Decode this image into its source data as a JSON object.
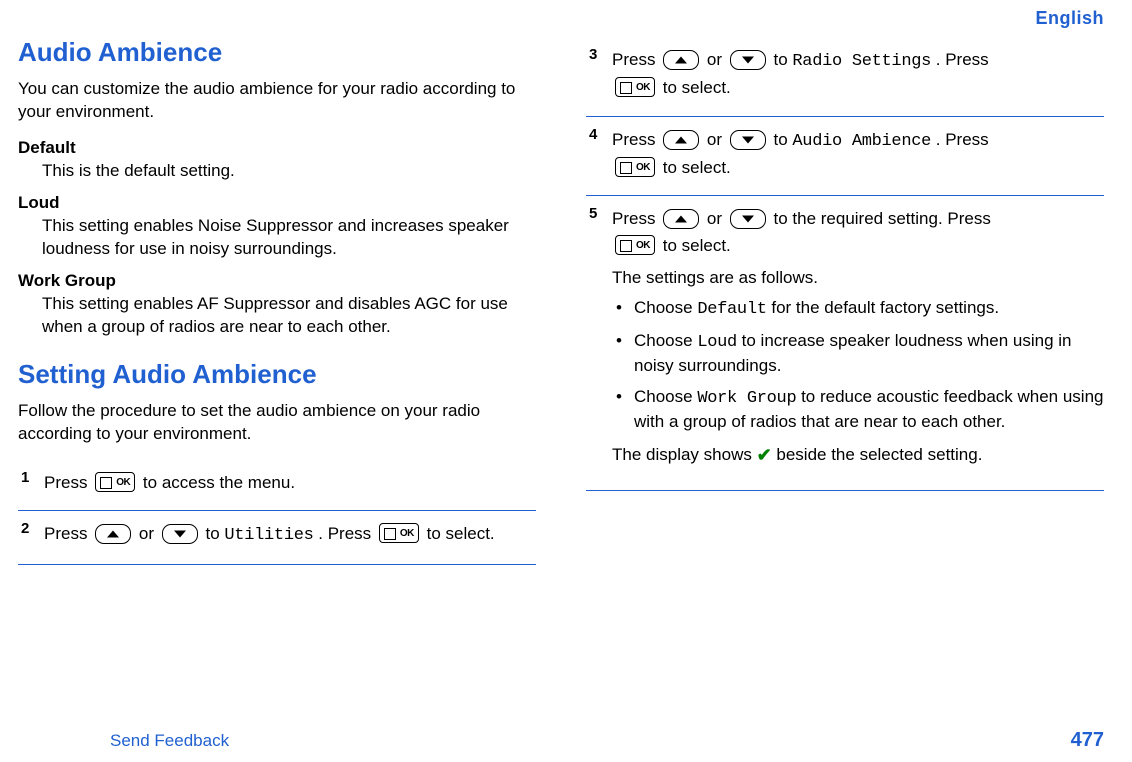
{
  "lang_label": "English",
  "left": {
    "h1": "Audio Ambience",
    "intro": "You can customize the audio ambience for your radio according to your environment.",
    "defs": [
      {
        "term": "Default",
        "desc": "This is the default setting."
      },
      {
        "term": "Loud",
        "desc": "This setting enables Noise Suppressor and increases speaker loudness for use in noisy surroundings."
      },
      {
        "term": "Work Group",
        "desc": "This setting enables AF Suppressor and disables AGC for use when a group of radios are near to each other."
      }
    ],
    "h2": "Setting Audio Ambience",
    "h2_intro": "Follow the procedure to set the audio ambience on your radio according to your environment.",
    "steps": {
      "s1": {
        "num": "1",
        "press": "Press ",
        "tail": " to access the menu."
      },
      "s2": {
        "num": "2",
        "press": "Press ",
        "or": " or ",
        "to1": " to ",
        "menu": "Utilities",
        "p2": ". Press ",
        "tail": " to select."
      }
    }
  },
  "right": {
    "steps": {
      "s3": {
        "num": "3",
        "press": "Press ",
        "or": " or ",
        "to1": " to ",
        "menu": "Radio Settings",
        "p2": ". Press",
        "tail": " to select."
      },
      "s4": {
        "num": "4",
        "press": "Press ",
        "or": " or ",
        "to1": " to ",
        "menu": "Audio Ambience",
        "p2": ". Press",
        "tail": " to select."
      },
      "s5": {
        "num": "5",
        "press": "Press ",
        "or": " or ",
        "to1": " to the required setting. Press",
        "tail": " to select.",
        "settings_lead": "The settings are as follows.",
        "bullets": [
          {
            "pre": "Choose ",
            "code": "Default",
            "post": " for the default factory settings."
          },
          {
            "pre": "Choose ",
            "code": "Loud",
            "post": " to increase speaker loudness when using in noisy surroundings."
          },
          {
            "pre": "Choose ",
            "code": "Work Group",
            "post": " to reduce acoustic feedback when using with a group of radios that are near to each other."
          }
        ],
        "display_pre": "The display shows ",
        "display_post": " beside the selected setting."
      }
    }
  },
  "footer": {
    "feedback": "Send Feedback",
    "page": "477"
  }
}
